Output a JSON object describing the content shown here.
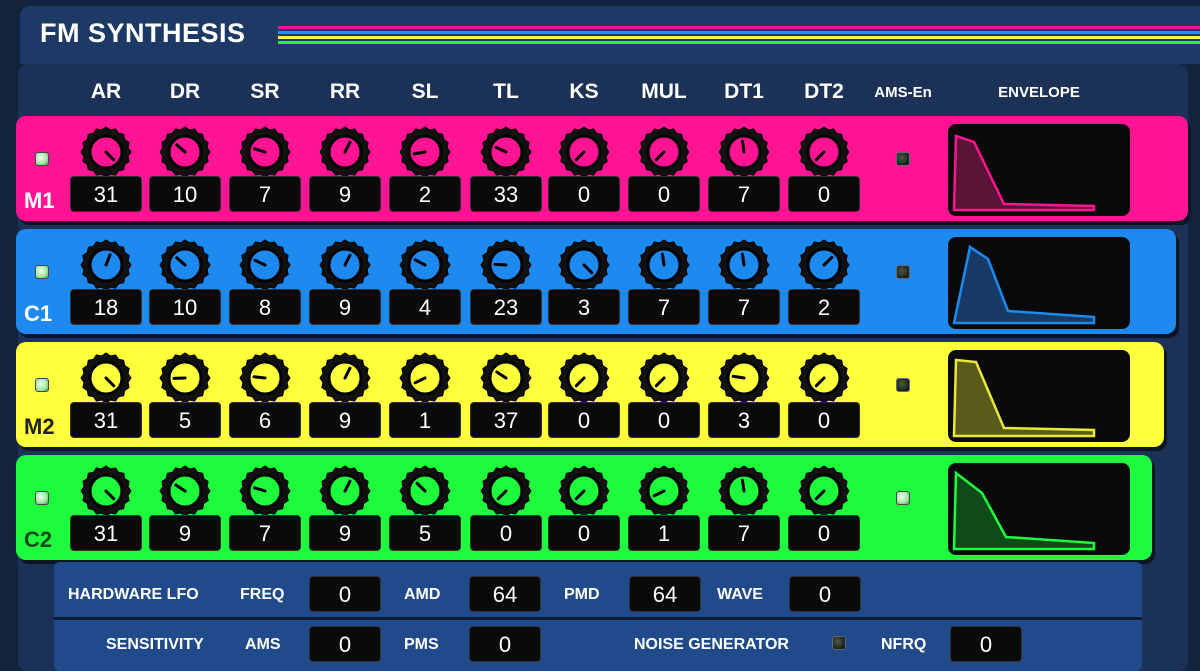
{
  "app": {
    "title": "FM SYNTHESIS",
    "stripe_colors": [
      "#ff1493",
      "#1e90ff",
      "#ffff3c",
      "#1dfb3c"
    ]
  },
  "columns": {
    "params": [
      "AR",
      "DR",
      "SR",
      "RR",
      "SL",
      "TL",
      "KS",
      "MUL",
      "DT1",
      "DT2"
    ],
    "ams_label": "AMS-En",
    "envelope_label": "ENVELOPE"
  },
  "operators": [
    {
      "label": "M1",
      "color": "#ff1493",
      "label_color": "#ffffff",
      "enabled": true,
      "ams_enabled": false,
      "values": [
        "31",
        "10",
        "7",
        "9",
        "2",
        "33",
        "0",
        "0",
        "7",
        "0"
      ],
      "knob_levels": [
        1.0,
        0.32,
        0.23,
        0.6,
        0.13,
        0.26,
        0.0,
        0.0,
        0.47,
        0.0
      ],
      "envelope_color": "#ff1493",
      "envelope_fill": "#5a1438"
    },
    {
      "label": "C1",
      "color": "#1e8af0",
      "label_color": "#ffffff",
      "enabled": true,
      "ams_enabled": false,
      "values": [
        "18",
        "10",
        "8",
        "9",
        "4",
        "23",
        "3",
        "7",
        "7",
        "2"
      ],
      "knob_levels": [
        0.58,
        0.32,
        0.26,
        0.6,
        0.27,
        0.18,
        1.0,
        0.47,
        0.47,
        0.67
      ],
      "envelope_color": "#1e8af0",
      "envelope_fill": "#173a66"
    },
    {
      "label": "M2",
      "color": "#ffff3c",
      "label_color": "#222222",
      "enabled": true,
      "ams_enabled": false,
      "values": [
        "31",
        "5",
        "6",
        "9",
        "1",
        "37",
        "0",
        "0",
        "3",
        "0"
      ],
      "knob_levels": [
        1.0,
        0.16,
        0.19,
        0.6,
        0.07,
        0.29,
        0.0,
        0.0,
        0.2,
        0.0
      ],
      "envelope_color": "#e8e83a",
      "envelope_fill": "#5a5a1a"
    },
    {
      "label": "C2",
      "color": "#1dfb3c",
      "label_color": "#1a4a1a",
      "enabled": true,
      "ams_enabled": true,
      "values": [
        "31",
        "9",
        "7",
        "9",
        "5",
        "0",
        "0",
        "1",
        "7",
        "0"
      ],
      "knob_levels": [
        1.0,
        0.29,
        0.23,
        0.6,
        0.33,
        0.0,
        0.0,
        0.07,
        0.47,
        0.0
      ],
      "envelope_color": "#1dfb3c",
      "envelope_fill": "#0f4a1a"
    }
  ],
  "hardware_lfo": {
    "label": "HARDWARE LFO",
    "freq_label": "FREQ",
    "freq_value": "0",
    "amd_label": "AMD",
    "amd_value": "64",
    "pmd_label": "PMD",
    "pmd_value": "64",
    "wave_label": "WAVE",
    "wave_value": "0"
  },
  "sensitivity": {
    "label": "SENSITIVITY",
    "ams_label": "AMS",
    "ams_value": "0",
    "pms_label": "PMS",
    "pms_value": "0",
    "noise_label": "NOISE GENERATOR",
    "noise_enabled": false,
    "nfrq_label": "NFRQ",
    "nfrq_value": "0"
  }
}
